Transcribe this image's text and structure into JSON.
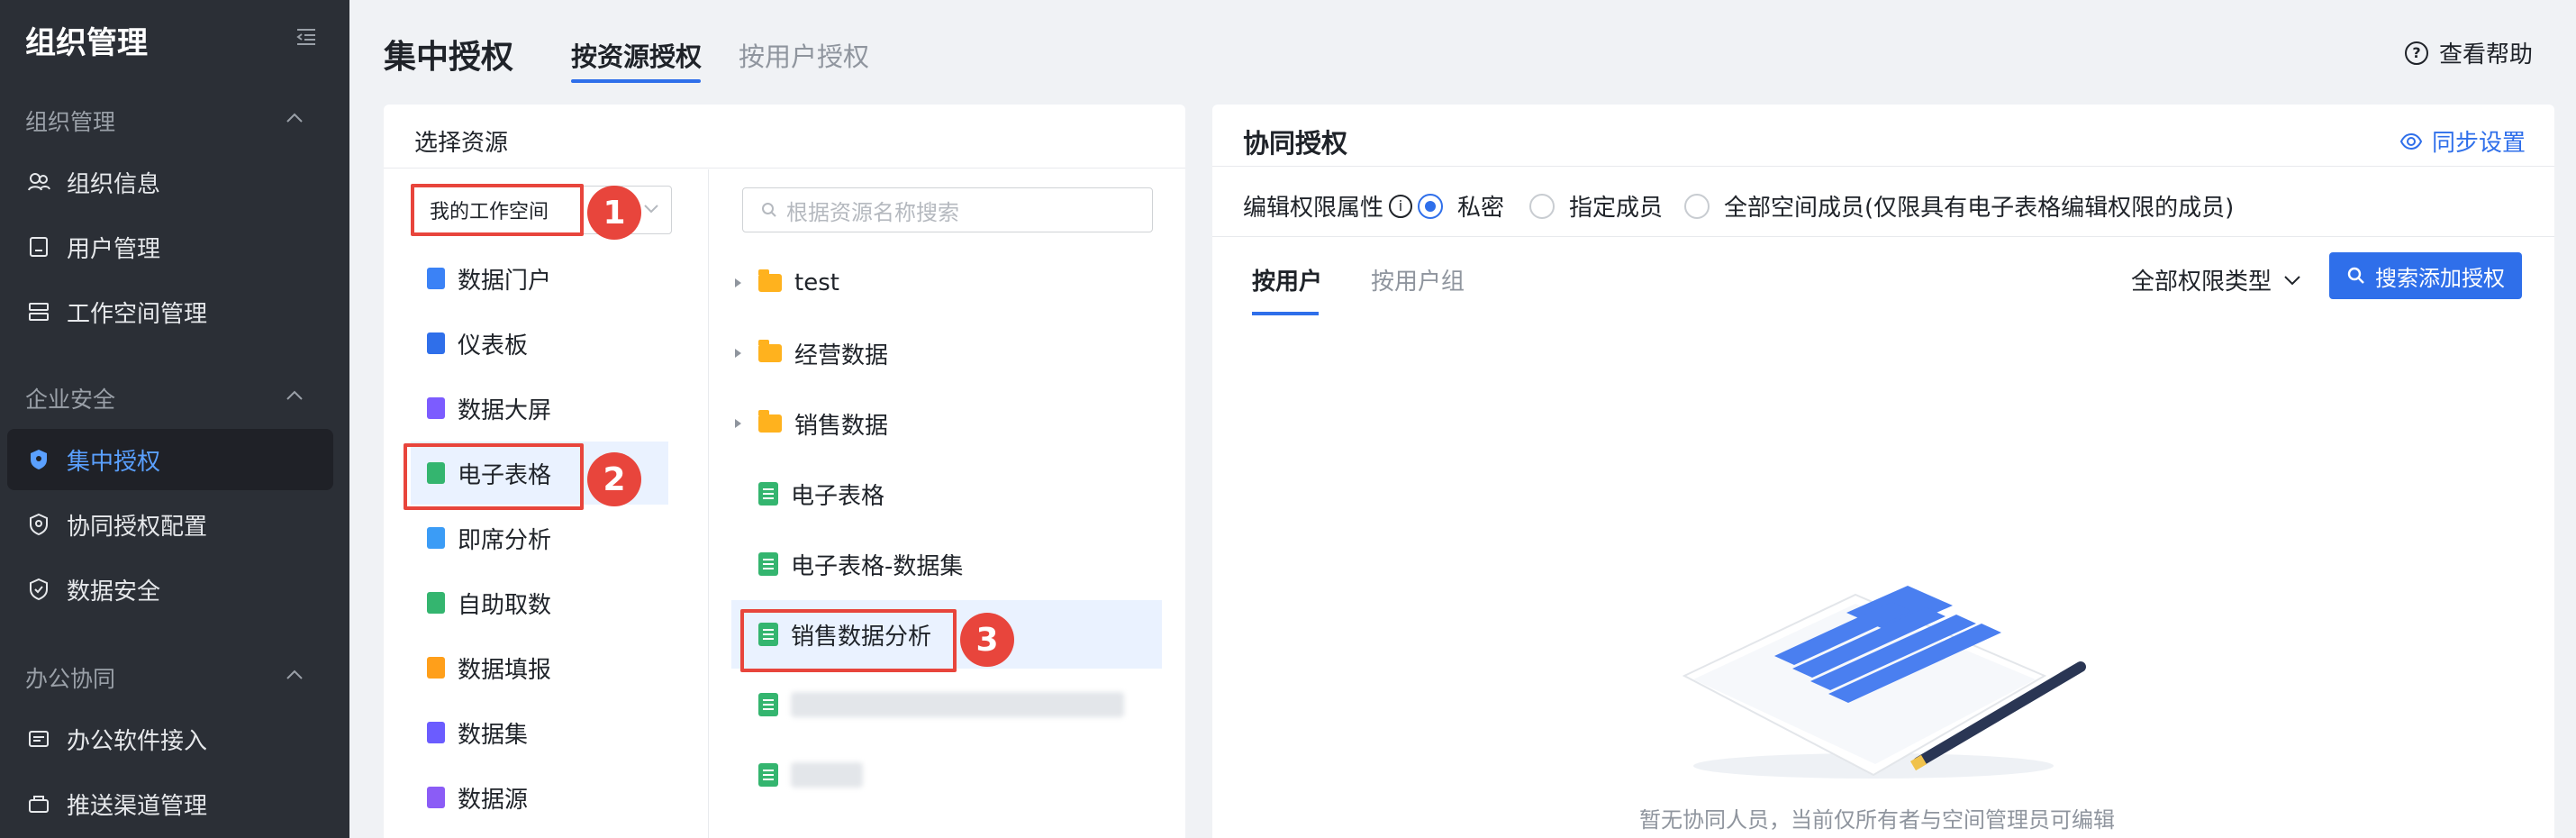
{
  "sidebar": {
    "title": "组织管理",
    "groups": [
      {
        "label": "组织管理",
        "items": [
          {
            "label": "组织信息",
            "icon": "org-info-icon"
          },
          {
            "label": "用户管理",
            "icon": "user-manage-icon"
          },
          {
            "label": "工作空间管理",
            "icon": "workspace-icon"
          }
        ]
      },
      {
        "label": "企业安全",
        "items": [
          {
            "label": "集中授权",
            "icon": "shield-icon",
            "active": true
          },
          {
            "label": "协同授权配置",
            "icon": "shield-outline-icon"
          },
          {
            "label": "数据安全",
            "icon": "shield-check-icon"
          }
        ]
      },
      {
        "label": "办公协同",
        "items": [
          {
            "label": "办公软件接入",
            "icon": "office-icon"
          },
          {
            "label": "推送渠道管理",
            "icon": "push-icon"
          }
        ]
      }
    ]
  },
  "header": {
    "title": "集中授权",
    "tabs": [
      {
        "label": "按资源授权",
        "active": true
      },
      {
        "label": "按用户授权"
      }
    ],
    "help": "查看帮助"
  },
  "left_panel": {
    "title": "选择资源",
    "workspace_select": "我的工作空间",
    "resource_types": [
      {
        "label": "数据门户",
        "color": "#3b82f6"
      },
      {
        "label": "仪表板",
        "color": "#2f6fea"
      },
      {
        "label": "数据大屏",
        "color": "#7c5cff"
      },
      {
        "label": "电子表格",
        "color": "#34b56f",
        "selected": true
      },
      {
        "label": "即席分析",
        "color": "#3b9cf6"
      },
      {
        "label": "自助取数",
        "color": "#34b56f"
      },
      {
        "label": "数据填报",
        "color": "#ff9f1a"
      },
      {
        "label": "数据集",
        "color": "#6b5cff"
      },
      {
        "label": "数据源",
        "color": "#8b5cf6"
      }
    ],
    "search_placeholder": "根据资源名称搜索",
    "tree": [
      {
        "label": "test",
        "type": "folder"
      },
      {
        "label": "经营数据",
        "type": "folder"
      },
      {
        "label": "销售数据",
        "type": "folder"
      },
      {
        "label": "电子表格",
        "type": "sheet"
      },
      {
        "label": "电子表格-数据集",
        "type": "sheet"
      },
      {
        "label": "销售数据分析",
        "type": "sheet",
        "selected": true
      },
      {
        "label": "",
        "type": "sheet",
        "blurred": true
      },
      {
        "label": "",
        "type": "sheet",
        "blurred": true
      }
    ]
  },
  "annotations": [
    "1",
    "2",
    "3"
  ],
  "right_panel": {
    "title": "协同授权",
    "sync_settings": "同步设置",
    "perm_label": "编辑权限属性",
    "radios": [
      {
        "label": "私密",
        "checked": true
      },
      {
        "label": "指定成员"
      },
      {
        "label": "全部空间成员(仅限具有电子表格编辑权限的成员)"
      }
    ],
    "subtabs": [
      {
        "label": "按用户",
        "active": true
      },
      {
        "label": "按用户组"
      }
    ],
    "perm_type": "全部权限类型",
    "add_button": "搜索添加授权",
    "empty_text": "暂无协同人员，当前仅所有者与空间管理员可编辑"
  },
  "colors": {
    "accent": "#2f6fea",
    "sidebar_bg": "#2b2f36",
    "annotation": "#e8453c"
  }
}
